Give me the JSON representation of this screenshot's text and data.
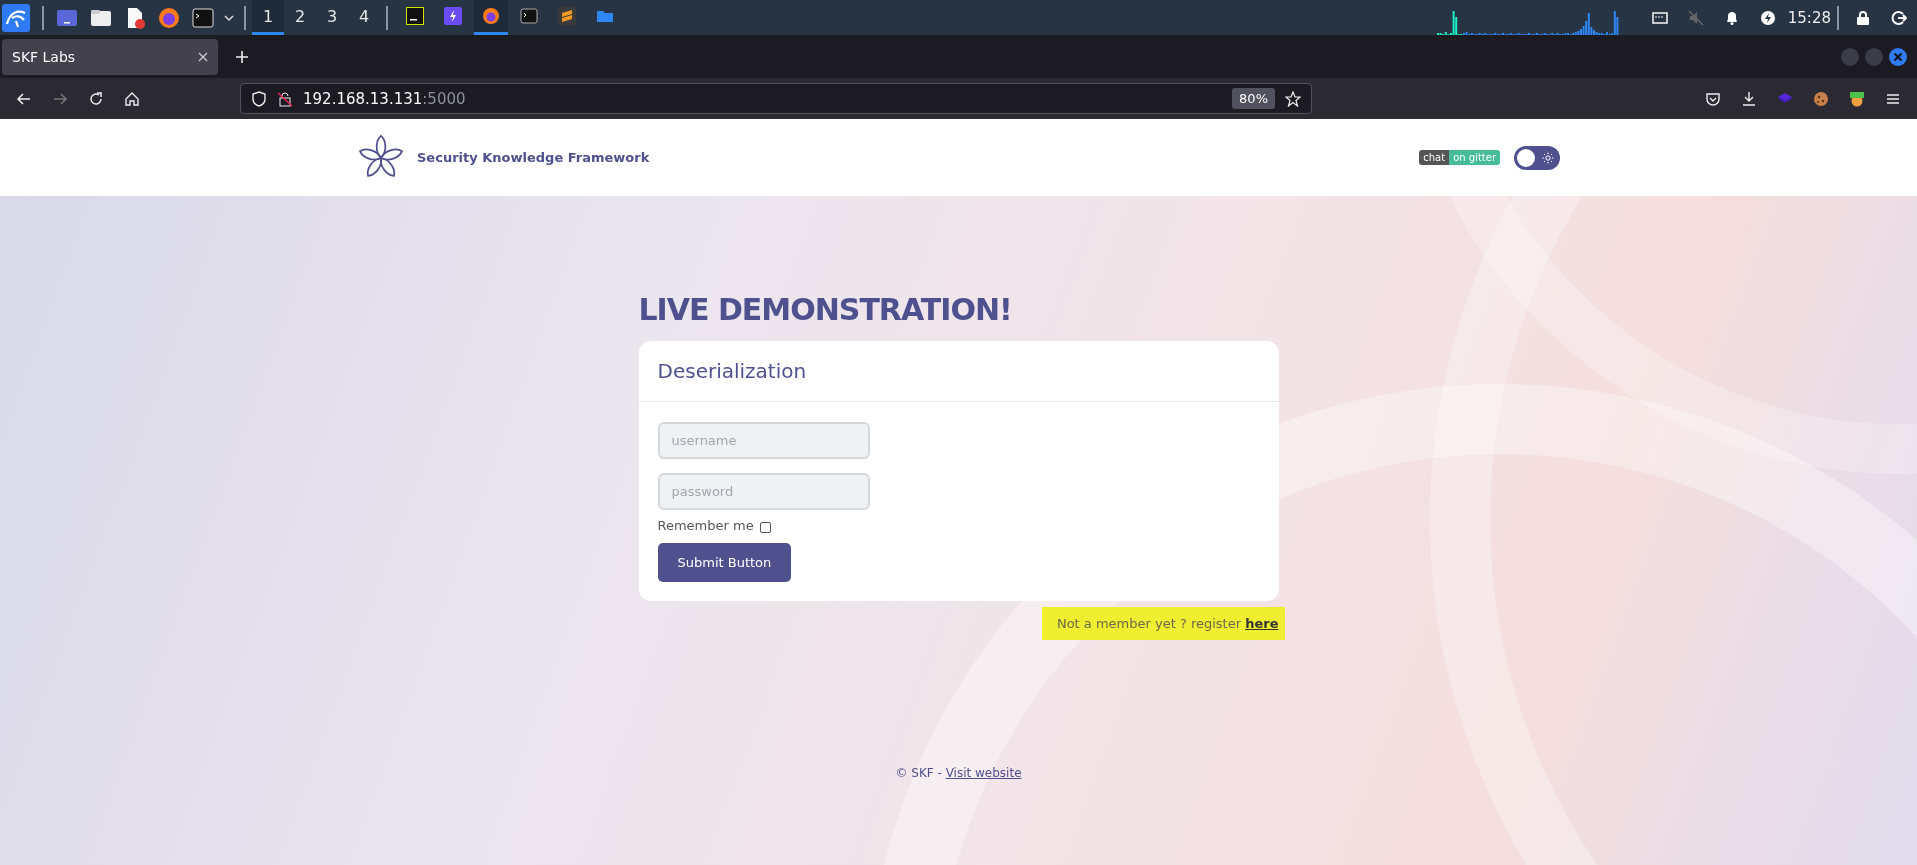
{
  "taskbar": {
    "workspaces": [
      {
        "label": "1",
        "selected": true
      },
      {
        "label": "2",
        "selected": false
      },
      {
        "label": "3",
        "selected": false
      },
      {
        "label": "4",
        "selected": false
      }
    ],
    "tasks": [
      {
        "kind": "pycharm",
        "selected": false
      },
      {
        "kind": "bolt",
        "selected": false
      },
      {
        "kind": "firefox",
        "selected": true
      },
      {
        "kind": "terminal",
        "selected": false
      },
      {
        "kind": "sublime",
        "selected": false
      },
      {
        "kind": "folder",
        "selected": false
      }
    ],
    "clock": "15:28"
  },
  "browser": {
    "tab_title": "SKF Labs",
    "url_host": "192.168.13.131",
    "url_port": ":5000",
    "zoom": "80%"
  },
  "page": {
    "brand": "Security Knowledge Framework",
    "badge_left": "chat",
    "badge_right": "on gitter",
    "theme_toggle_on": false,
    "heading": "LIVE DEMONSTRATION!",
    "card_title": "Deserialization",
    "username_placeholder": "username",
    "password_placeholder": "password",
    "remember_label": "Remember me",
    "remember_checked": false,
    "submit": "Submit Button",
    "register_text": "Not a member yet ? register ",
    "register_link": "here",
    "footer_text": "© SKF - ",
    "footer_link": "Visit website"
  }
}
